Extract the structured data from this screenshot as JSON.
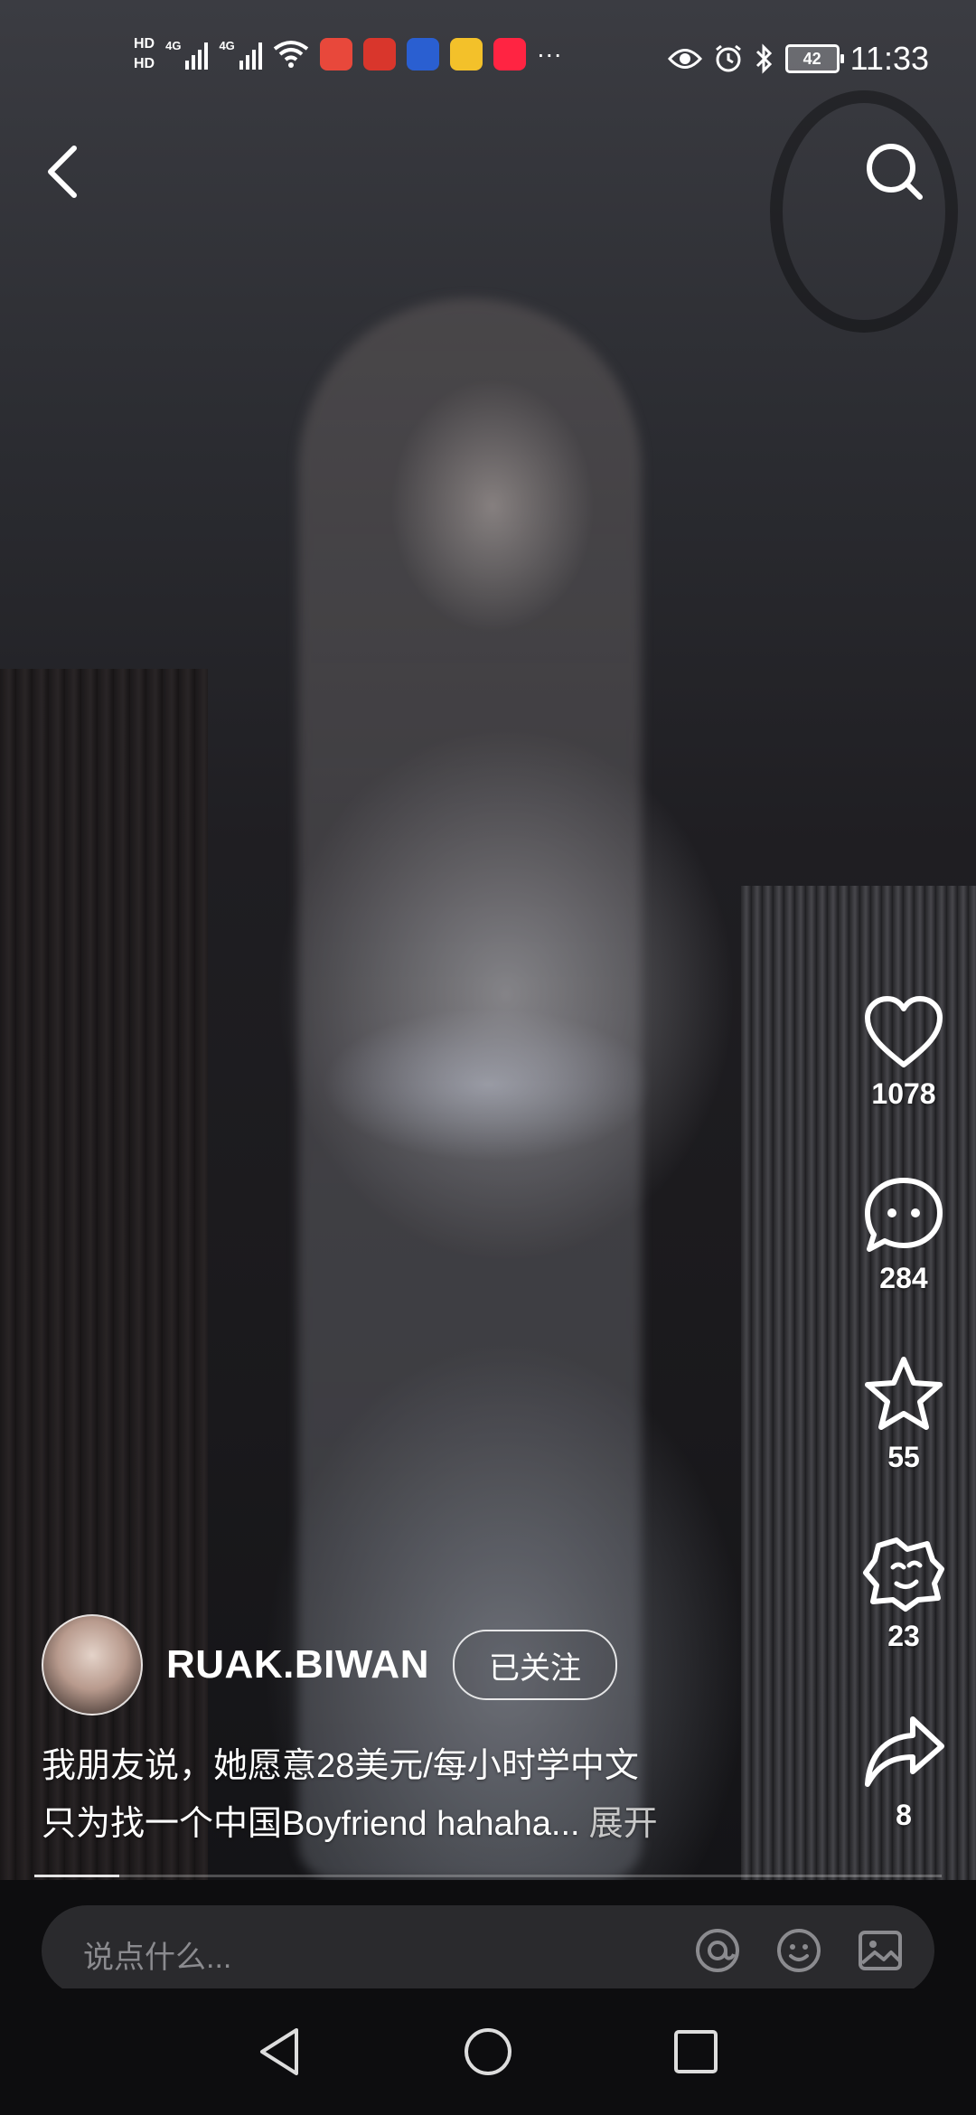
{
  "status_bar": {
    "hd1": "HD",
    "hd2": "HD",
    "net1": "4G",
    "net2": "4G",
    "more": "···",
    "battery": "42",
    "time": "11:33"
  },
  "video": {
    "actions": {
      "like_count": "1078",
      "comment_count": "284",
      "favorite_count": "55",
      "share_alt_count": "23",
      "share_count": "8"
    },
    "author": {
      "name": "RUAK.BIWAN",
      "follow_label": "已关注"
    },
    "caption": {
      "line1": "我朋友说，她愿意28美元/每小时学中文",
      "line2": "只为找一个中国Boyfriend hahaha...",
      "expand_label": "展开"
    }
  },
  "comment_bar": {
    "placeholder": "说点什么..."
  },
  "icons": {
    "back": "back-arrow-icon",
    "search": "search-icon",
    "like": "heart-icon",
    "comment": "comment-bubble-icon",
    "favorite": "star-icon",
    "share_alt": "sticker-icon",
    "share": "share-arrow-icon",
    "mention": "at-icon",
    "emoji": "emoji-icon",
    "image": "image-icon"
  },
  "colors": {
    "overlay_text": "#ffffff",
    "comment_box": "#2a2a2d",
    "placeholder": "#8b8b8f"
  }
}
